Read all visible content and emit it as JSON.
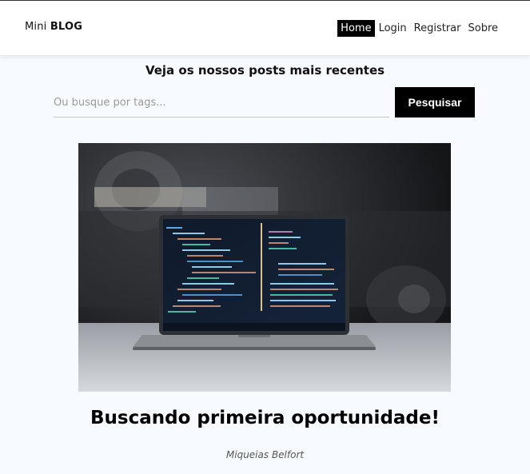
{
  "nav": {
    "brand_prefix": "Mini",
    "brand_bold": "BLOG",
    "links": [
      "Home",
      "Login",
      "Registrar",
      "Sobre"
    ],
    "active_link": "Home"
  },
  "hero": {
    "heading": "Veja os nossos posts mais recentes"
  },
  "search": {
    "placeholder": "Ou busque por tags...",
    "button_label": "Pesquisar"
  },
  "posts": [
    {
      "image_icon": "laptop-code-photo",
      "title": "Buscando primeira oportunidade!",
      "author": "Miqueias Belfort"
    }
  ]
}
